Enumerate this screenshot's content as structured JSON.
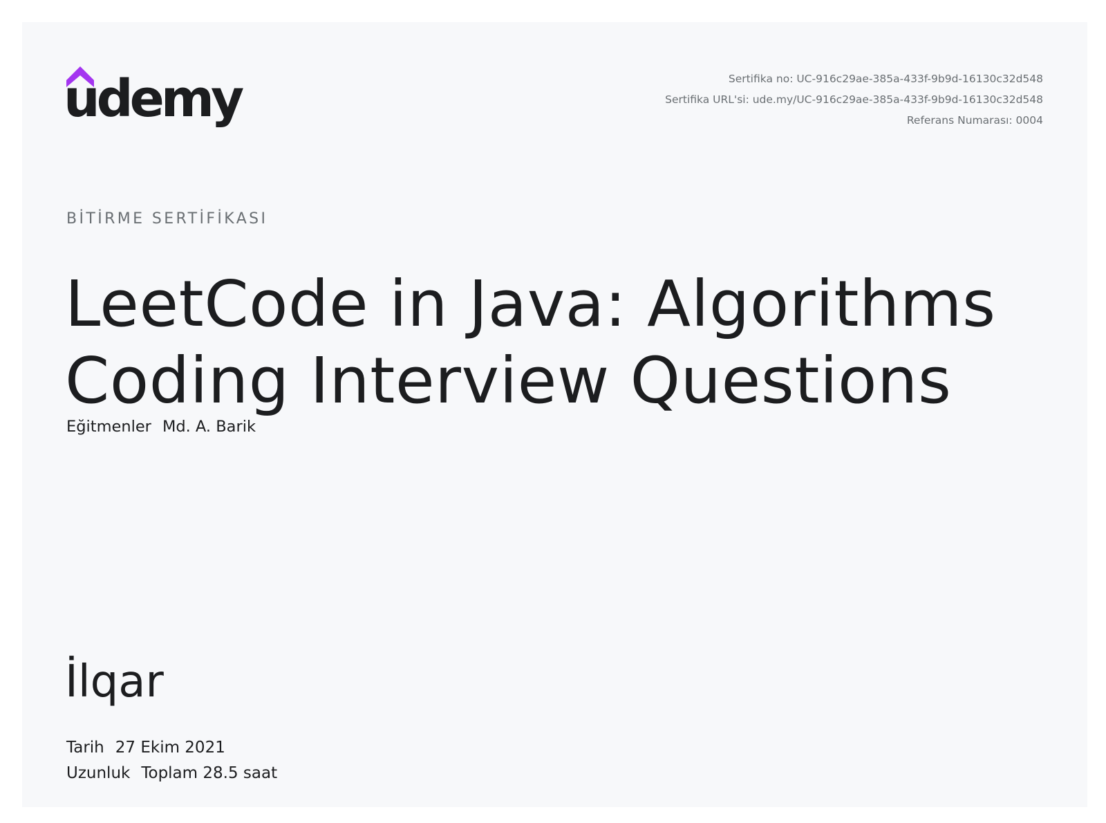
{
  "brand": {
    "logo_text": "udemy",
    "accent_color": "#a435f0",
    "text_color": "#1c1d1f"
  },
  "meta": {
    "certificate_no": "Sertifika no: UC-916c29ae-385a-433f-9b9d-16130c32d548",
    "certificate_url": "Sertifika URL'si: ude.my/UC-916c29ae-385a-433f-9b9d-16130c32d548",
    "reference_number": "Referans Numarası: 0004"
  },
  "certificate": {
    "kicker": "BİTİRME SERTİFİKASI",
    "course_title_line1": "LeetCode in Java: Algorithms",
    "course_title_line2": "Coding Interview Questions",
    "instructors_label": "Eğitmenler",
    "instructors_value": "Md. A. Barik",
    "recipient_name": "İlqar",
    "date_label": "Tarih",
    "date_value": "27 Ekim 2021",
    "length_label": "Uzunluk",
    "length_value": "Toplam 28.5 saat"
  }
}
